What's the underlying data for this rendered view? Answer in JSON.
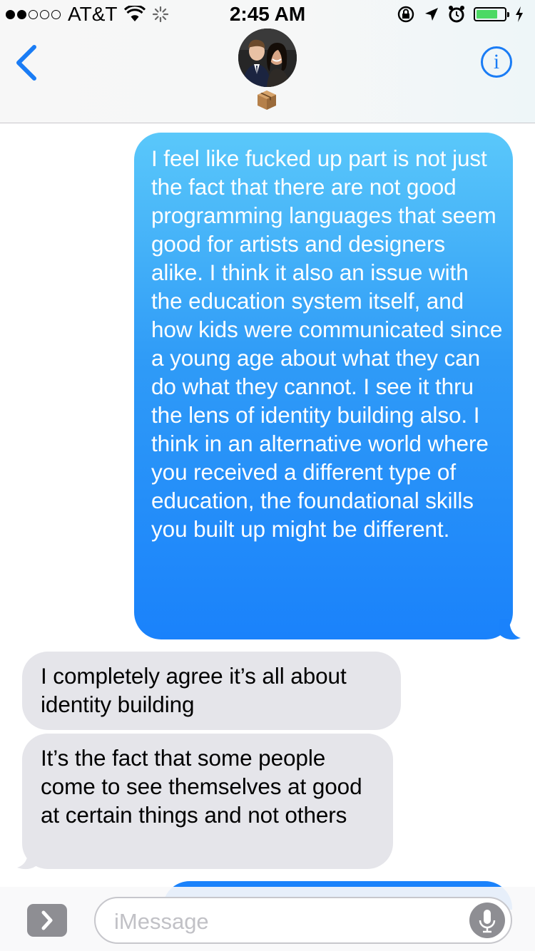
{
  "status_bar": {
    "carrier": "AT&T",
    "time": "2:45 AM",
    "battery_level": 0.7
  },
  "header": {
    "back_icon": "chevron-left-icon",
    "info_label": "i",
    "accent_color": "#1a7cf5"
  },
  "messages": [
    {
      "direction": "outgoing",
      "text": "I feel like fucked up part is not just the fact that there are not good programming languages that seem good for artists and designers alike. I think it also an issue with the education system itself, and how kids were communicated since a young age about what they can do what they cannot. I see it thru the lens of identity building also. I think in an alternative world where you received a different type of education, the foundational skills you built up might be different."
    },
    {
      "direction": "incoming",
      "text": "I completely agree it’s all about identity building"
    },
    {
      "direction": "incoming",
      "text": "It’s the fact that some people come to see themselves at good at certain things and not others"
    }
  ],
  "input": {
    "placeholder": "iMessage"
  },
  "colors": {
    "outgoing_top": "#5ac8fa",
    "outgoing_bottom": "#1a82fb",
    "incoming": "#e5e5ea"
  }
}
